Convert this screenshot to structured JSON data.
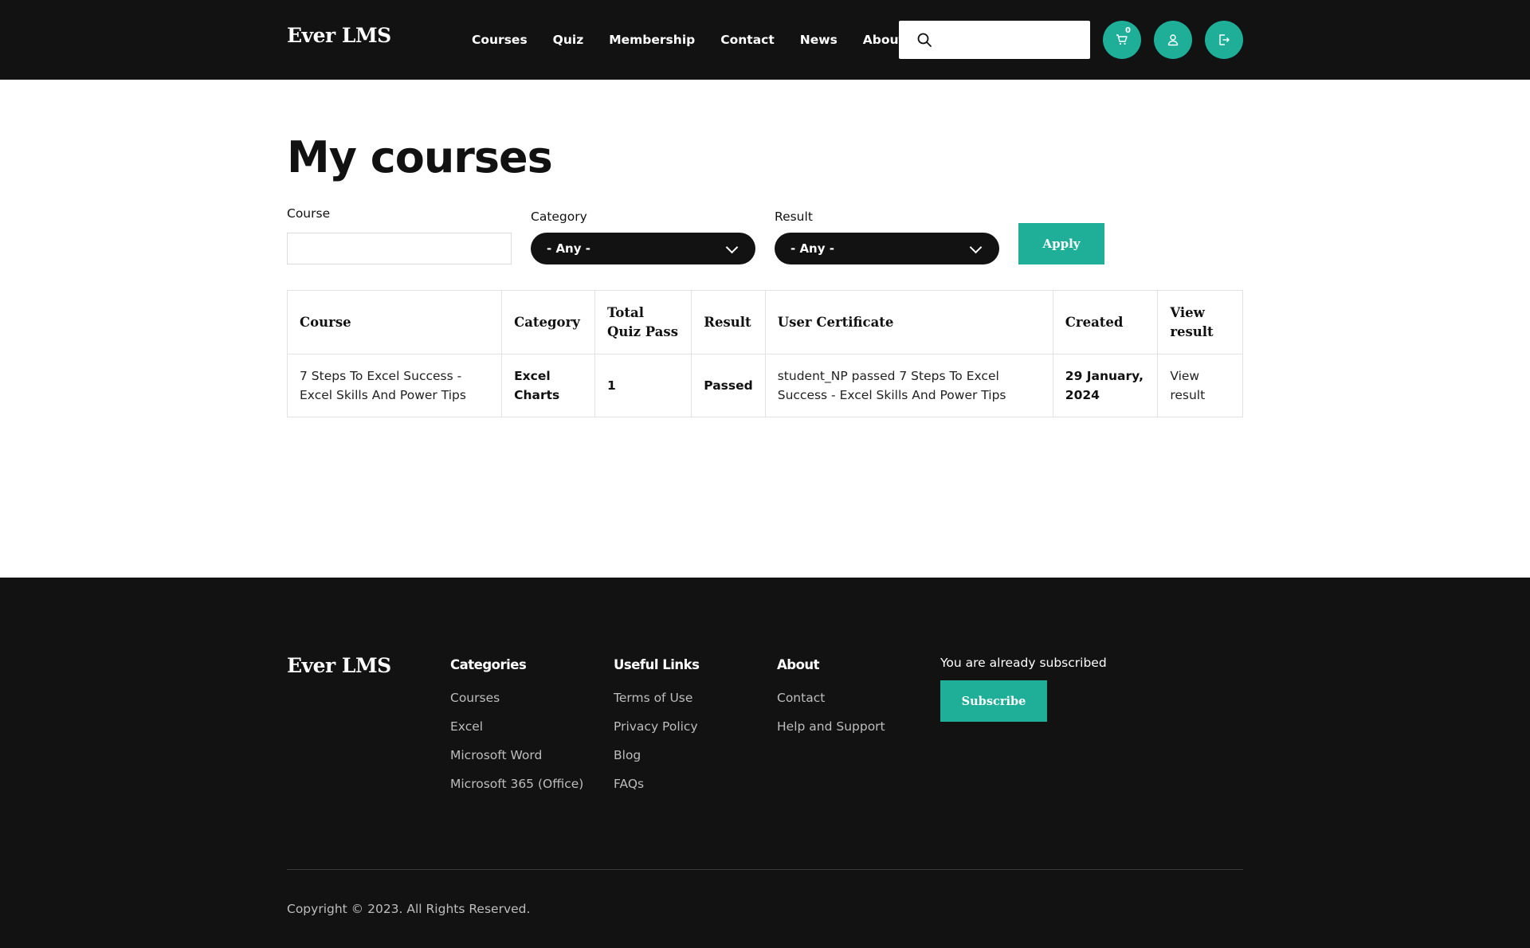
{
  "header": {
    "logo": "Ever LMS",
    "nav": {
      "courses": "Courses",
      "quiz": "Quiz",
      "membership": "Membership",
      "contact": "Contact",
      "news": "News",
      "about": "About"
    },
    "search_value": "",
    "cart_count": "0",
    "icons": {
      "search": "search-icon",
      "cart": "cart-icon",
      "user": "user-icon",
      "logout": "logout-icon"
    }
  },
  "main": {
    "title": "My courses",
    "filters": {
      "course_label": "Course",
      "course_value": "",
      "category_label": "Category",
      "category_value": "- Any -",
      "result_label": "Result",
      "result_value": "- Any -",
      "apply_label": "Apply"
    },
    "table": {
      "headers": {
        "course": "Course",
        "category": "Category",
        "total_quiz_pass": "Total Quiz Pass",
        "result": "Result",
        "user_certificate": "User Certificate",
        "created": "Created",
        "view_result": "View result"
      },
      "rows": [
        {
          "course": "7 Steps To Excel Success - Excel Skills And Power Tips",
          "category": "Excel Charts",
          "total_quiz_pass": "1",
          "result": "Passed",
          "user_certificate": "student_NP passed 7 Steps To Excel Success - Excel Skills And Power Tips",
          "created": "29 January, 2024",
          "view_result": "View result"
        }
      ]
    }
  },
  "footer": {
    "logo": "Ever LMS",
    "categories": {
      "heading": "Categories",
      "links": [
        "Courses",
        "Excel",
        "Microsoft Word",
        "Microsoft 365 (Office)"
      ]
    },
    "useful_links": {
      "heading": "Useful Links",
      "links": [
        "Terms of Use",
        "Privacy Policy",
        "Blog",
        "FAQs"
      ]
    },
    "about": {
      "heading": "About",
      "links": [
        "Contact",
        "Help and Support"
      ]
    },
    "subscribe_text": "You are already subscribed",
    "subscribe_label": "Subscribe",
    "copyright": "Copyright © 2023. All Rights Reserved."
  },
  "colors": {
    "accent": "#1fae98",
    "dark": "#121212",
    "border": "#e2e2e2"
  }
}
